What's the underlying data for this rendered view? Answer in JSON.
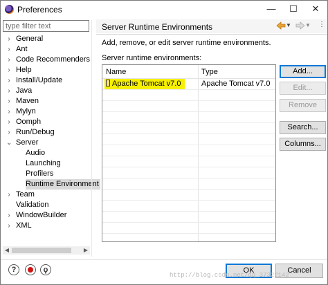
{
  "window": {
    "title": "Preferences",
    "controls": {
      "minimize": "—",
      "maximize": "☐",
      "close": "✕"
    }
  },
  "filter": {
    "placeholder": "type filter text"
  },
  "tree": {
    "items": [
      {
        "label": "General",
        "expandable": true,
        "level": 0
      },
      {
        "label": "Ant",
        "expandable": true,
        "level": 0
      },
      {
        "label": "Code Recommenders",
        "expandable": true,
        "level": 0
      },
      {
        "label": "Help",
        "expandable": true,
        "level": 0
      },
      {
        "label": "Install/Update",
        "expandable": true,
        "level": 0
      },
      {
        "label": "Java",
        "expandable": true,
        "level": 0
      },
      {
        "label": "Maven",
        "expandable": true,
        "level": 0
      },
      {
        "label": "Mylyn",
        "expandable": true,
        "level": 0
      },
      {
        "label": "Oomph",
        "expandable": true,
        "level": 0
      },
      {
        "label": "Run/Debug",
        "expandable": true,
        "level": 0
      },
      {
        "label": "Server",
        "expandable": true,
        "expanded": true,
        "level": 0
      },
      {
        "label": "Audio",
        "level": 1
      },
      {
        "label": "Launching",
        "level": 1
      },
      {
        "label": "Profilers",
        "level": 1
      },
      {
        "label": "Runtime Environment",
        "level": 1,
        "selected": true
      },
      {
        "label": "Team",
        "expandable": true,
        "level": 0
      },
      {
        "label": "Validation",
        "level": 0
      },
      {
        "label": "WindowBuilder",
        "expandable": true,
        "level": 0
      },
      {
        "label": "XML",
        "expandable": true,
        "level": 0
      }
    ]
  },
  "page": {
    "title": "Server Runtime Environments",
    "description": "Add, remove, or edit server runtime environments.",
    "table_caption": "Server runtime environments:"
  },
  "table": {
    "columns": [
      "Name",
      "Type"
    ],
    "rows": [
      {
        "name": "Apache Tomcat v7.0",
        "type": "Apache Tomcat v7.0",
        "checked": true,
        "highlight_color": "#f6f000"
      }
    ]
  },
  "buttons": {
    "add": "Add...",
    "edit": "Edit...",
    "remove": "Remove",
    "search": "Search...",
    "columns": "Columns..."
  },
  "footer": {
    "ok": "OK",
    "cancel": "Cancel",
    "watermark": "http://blog.csdn.net/qq_37322142"
  },
  "colors": {
    "accent": "#0078d7",
    "nav_back": "#e8a33a",
    "highlight": "#f6f000"
  }
}
